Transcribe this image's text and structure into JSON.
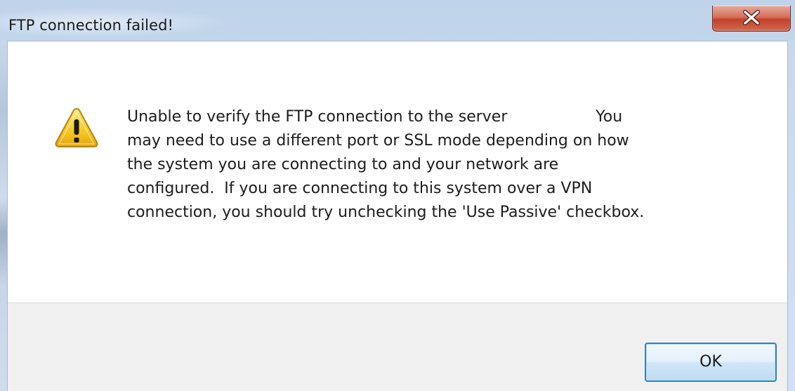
{
  "window": {
    "title": "FTP connection failed!",
    "close_icon": "close-x-icon"
  },
  "dialog": {
    "icon": "warning-icon",
    "message_lines": [
      "Unable to verify the FTP connection to the server                  You",
      "may need to use a different port or SSL mode depending on how",
      "the system you are connecting to and your network are",
      "configured.  If you are connecting to this system over a VPN",
      "connection, you should try unchecking the 'Use Passive' checkbox."
    ],
    "ok_label": "OK"
  },
  "colors": {
    "title_bar": "#c9dbef",
    "close_button": "#c2412a",
    "footer": "#f0f0f0",
    "ok_border": "#3c7fb1",
    "warning_fill": "#f7c21b"
  }
}
